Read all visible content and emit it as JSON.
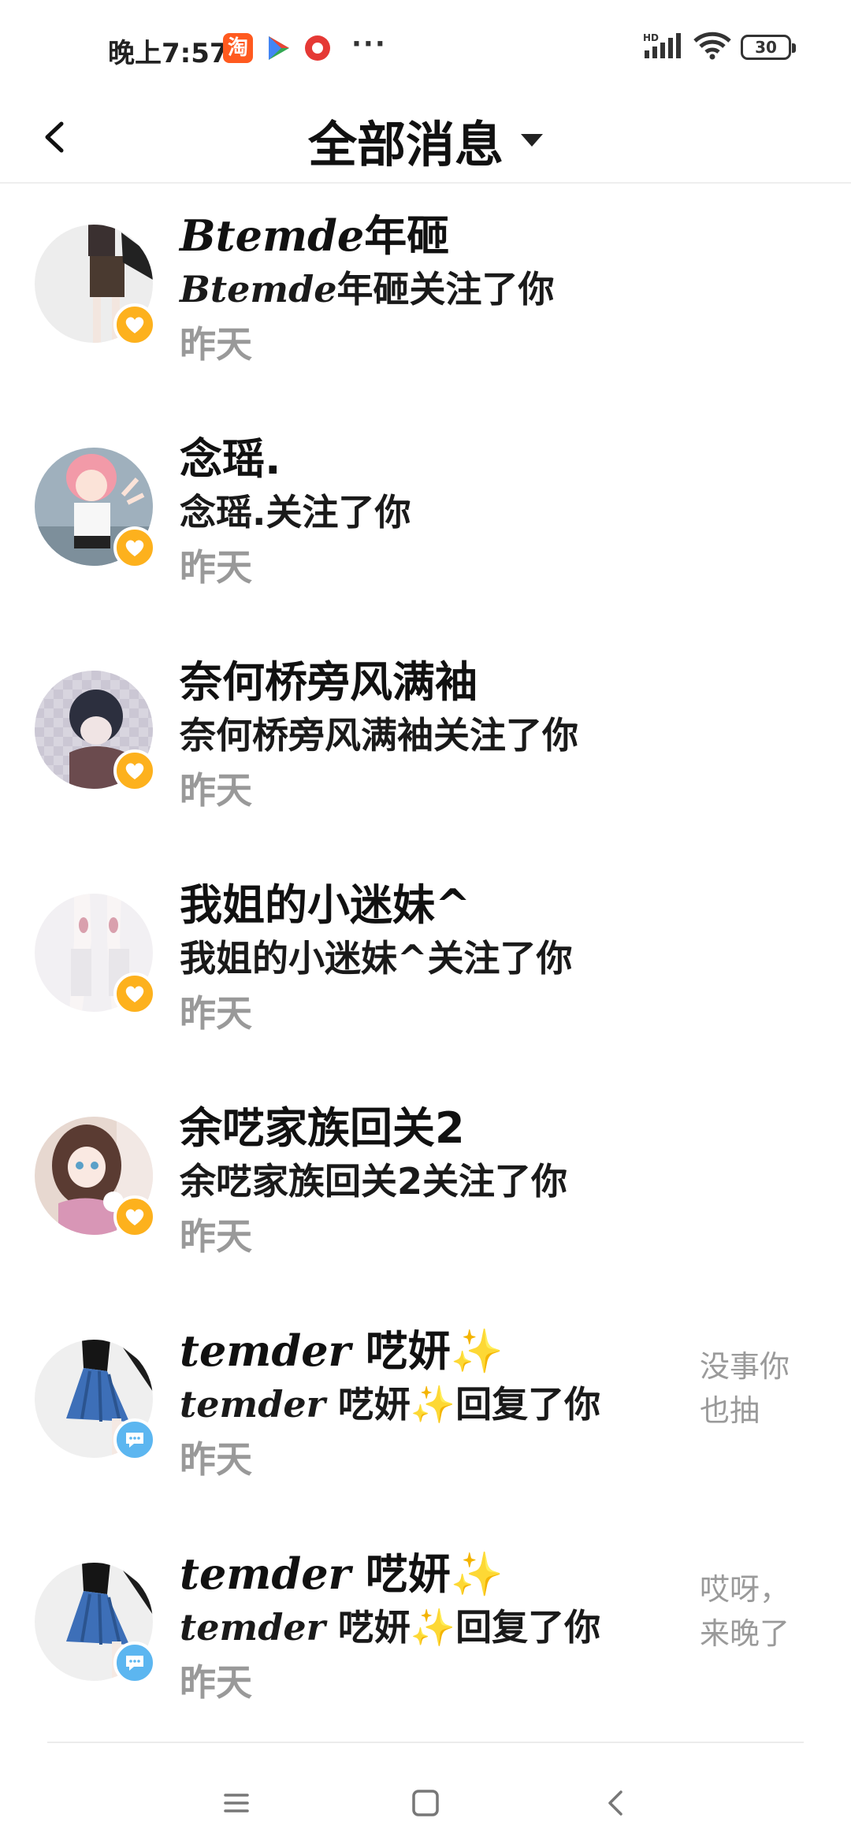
{
  "status_bar": {
    "time": "晚上7:57",
    "taobao_icon": "淘",
    "dots": "···",
    "network": "HD",
    "battery": "30"
  },
  "header": {
    "title": "全部消息"
  },
  "items": [
    {
      "name_script": "Btemde",
      "name": "年砸",
      "desc_script": "Btemde",
      "desc": "年砸关注了你",
      "time": "昨天",
      "type": "follow",
      "preview": ""
    },
    {
      "name_script": "",
      "name": "念瑶.",
      "desc_script": "",
      "desc": "念瑶.关注了你",
      "time": "昨天",
      "type": "follow",
      "preview": ""
    },
    {
      "name_script": "",
      "name": "奈何桥旁风满袖",
      "desc_script": "",
      "desc": "奈何桥旁风满袖关注了你",
      "time": "昨天",
      "type": "follow",
      "preview": ""
    },
    {
      "name_script": "",
      "name": "我姐的小迷妹^",
      "desc_script": "",
      "desc": "我姐的小迷妹^关注了你",
      "time": "昨天",
      "type": "follow",
      "preview": ""
    },
    {
      "name_script": "",
      "name": "余呓家族回关2",
      "desc_script": "",
      "desc": "余呓家族回关2关注了你",
      "time": "昨天",
      "type": "follow",
      "preview": ""
    },
    {
      "name_script": "temder",
      "name": "呓妍✨",
      "desc_script": "temder",
      "desc": "呓妍✨回复了你",
      "time": "昨天",
      "type": "reply",
      "preview": "没事你也抽"
    },
    {
      "name_script": "temder",
      "name": "呓妍✨",
      "desc_script": "temder",
      "desc": "呓妍✨回复了你",
      "time": "昨天",
      "type": "reply",
      "preview": "哎呀，来晚了"
    }
  ],
  "colors": {
    "follow_badge": "#fdb11d",
    "reply_badge": "#5cb6f0",
    "time_text": "#999999"
  }
}
